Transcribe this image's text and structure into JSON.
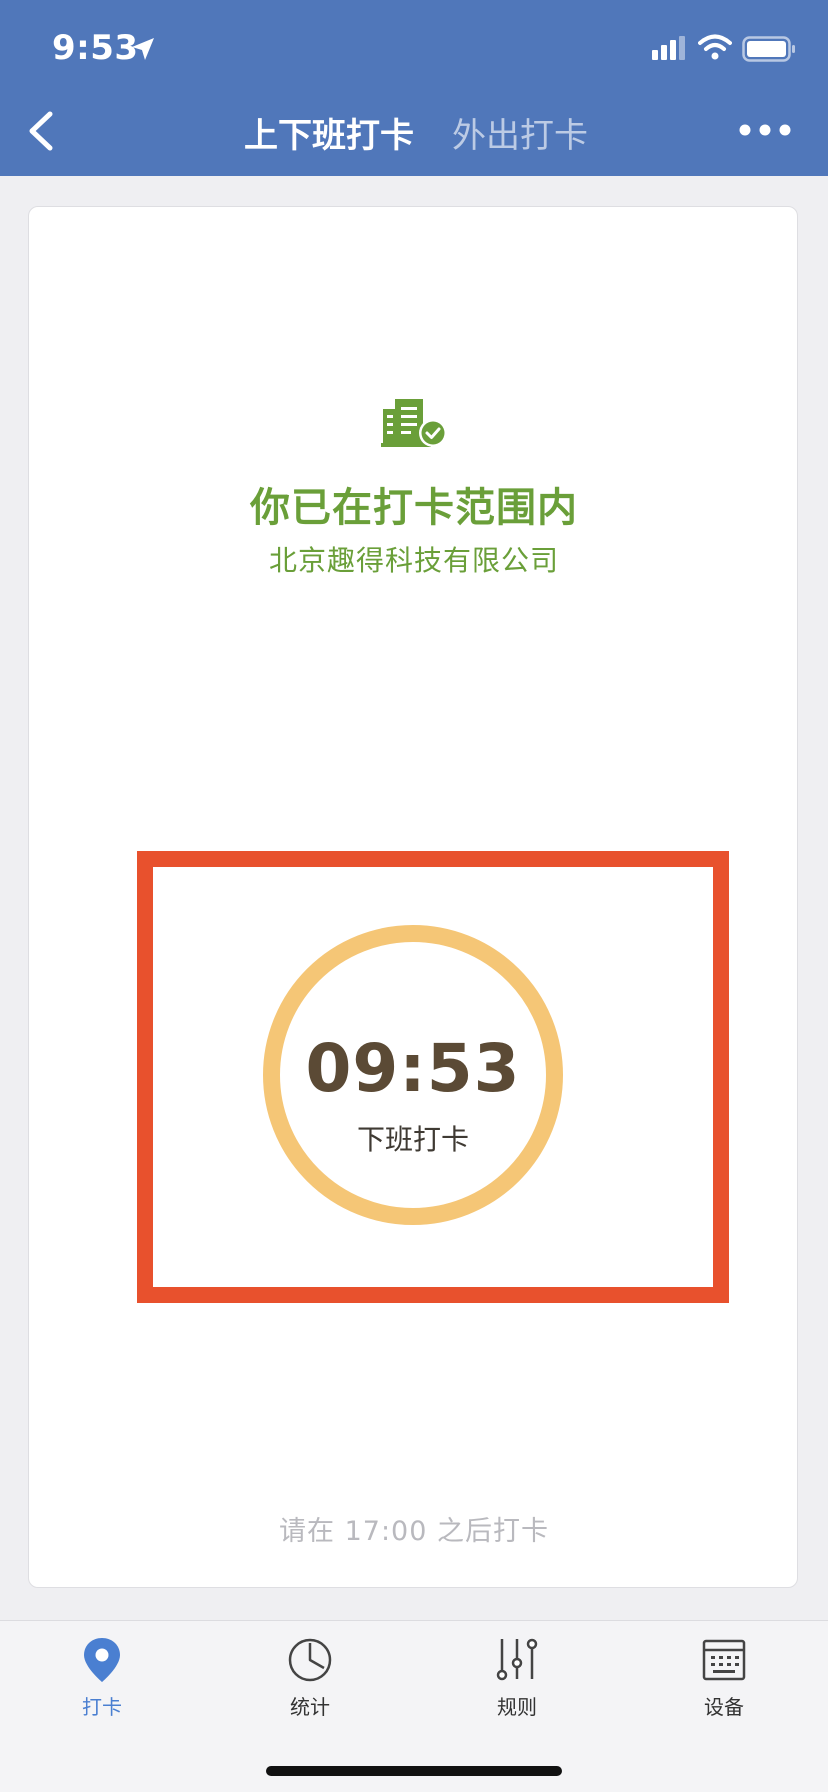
{
  "status_bar": {
    "time": "9:53"
  },
  "header": {
    "tabs": [
      {
        "label": "上下班打卡",
        "active": true
      },
      {
        "label": "外出打卡",
        "active": false
      }
    ],
    "background_color": "#5077ba"
  },
  "card": {
    "range_title": "你已在打卡范围内",
    "company": "北京趣得科技有限公司",
    "clock_button": {
      "time": "09:53",
      "label": "下班打卡",
      "ring_color": "#f5c676"
    },
    "hint": "请在 17:00 之后打卡",
    "highlight_color": "#e8512d"
  },
  "tabbar": {
    "items": [
      {
        "label": "打卡",
        "icon": "location-pin-icon",
        "active": true
      },
      {
        "label": "统计",
        "icon": "pie-chart-icon",
        "active": false
      },
      {
        "label": "规则",
        "icon": "sliders-icon",
        "active": false
      },
      {
        "label": "设备",
        "icon": "device-icon",
        "active": false
      }
    ],
    "active_color": "#4a7fd1"
  }
}
